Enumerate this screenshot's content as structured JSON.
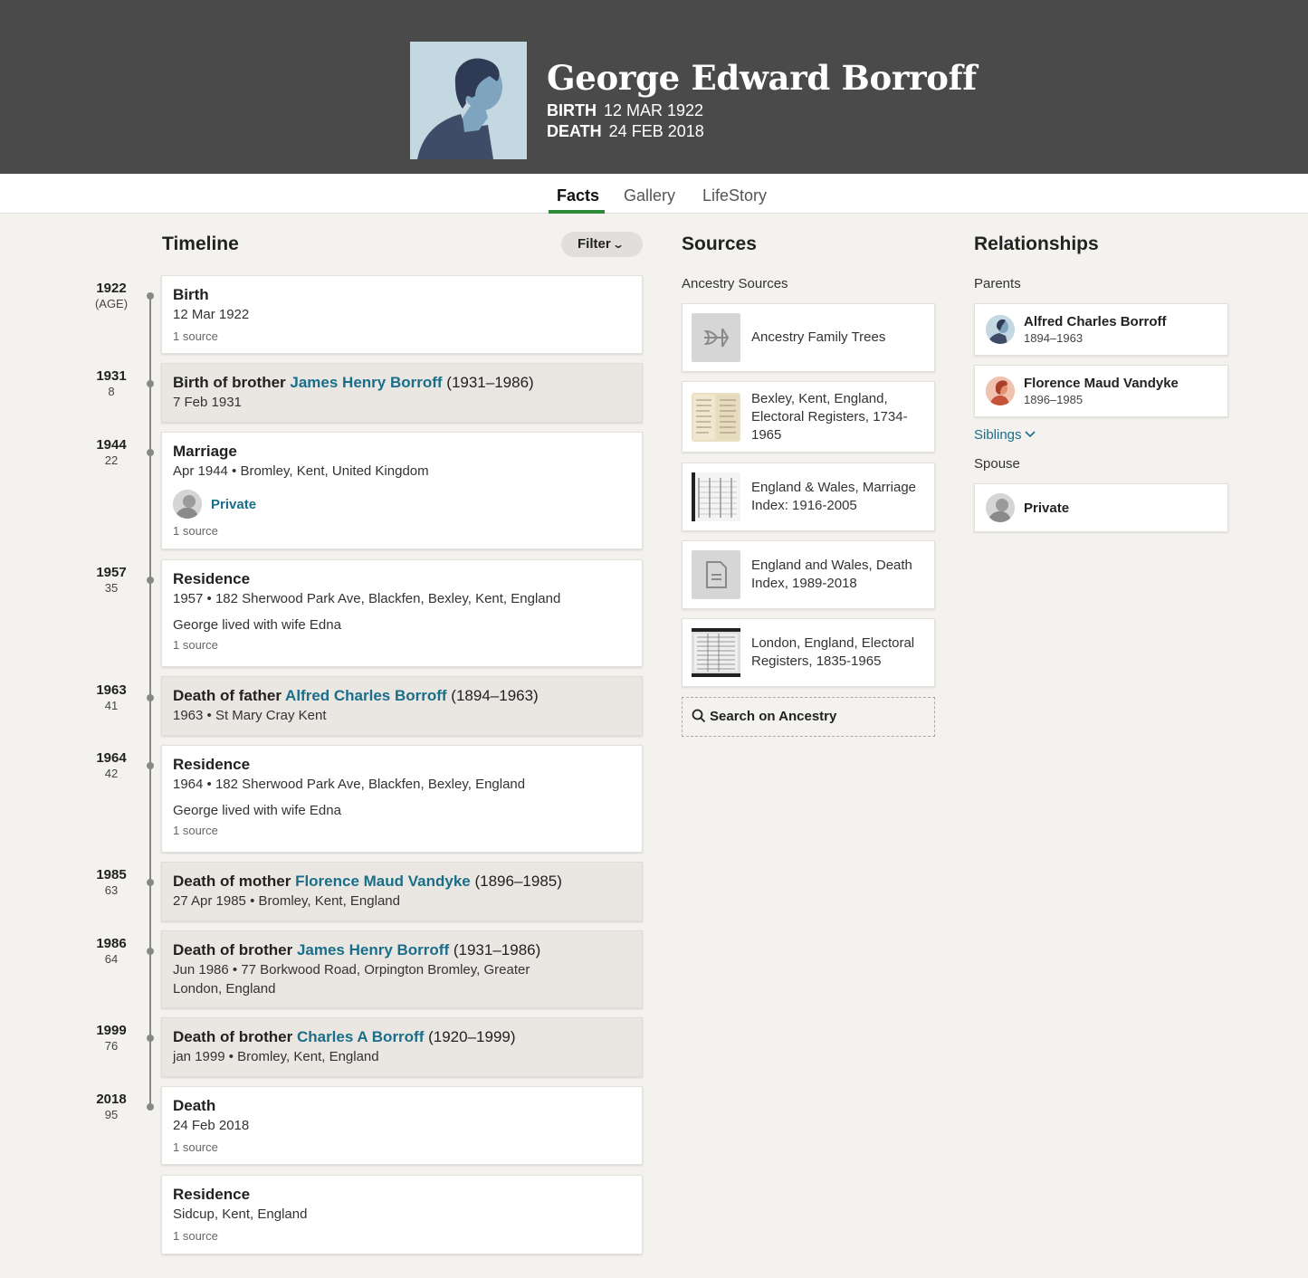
{
  "profile": {
    "name": "George Edward Borroff",
    "birth_label": "BIRTH",
    "birth_date": "12 MAR 1922",
    "death_label": "DEATH",
    "death_date": "24 FEB 2018"
  },
  "tabs": [
    "Facts",
    "Gallery",
    "LifeStory"
  ],
  "timeline": {
    "heading": "Timeline",
    "filter_label": "Filter",
    "years": [
      {
        "year": "1922",
        "age": "(AGE)"
      },
      {
        "year": "1931",
        "age": "8"
      },
      {
        "year": "1944",
        "age": "22"
      },
      {
        "year": "1957",
        "age": "35"
      },
      {
        "year": "1963",
        "age": "41"
      },
      {
        "year": "1964",
        "age": "42"
      },
      {
        "year": "1985",
        "age": "63"
      },
      {
        "year": "1986",
        "age": "64"
      },
      {
        "year": "1999",
        "age": "76"
      },
      {
        "year": "2018",
        "age": "95"
      }
    ],
    "events": [
      {
        "title": "Birth",
        "detail": "12 Mar 1922",
        "source": "1 source"
      },
      {
        "prefix": "Birth of brother ",
        "link": "James Henry Borroff",
        "dates": " (1931–1986)",
        "detail": "7 Feb 1931"
      },
      {
        "title": "Marriage",
        "detail": "Apr 1944 • Bromley, Kent, United Kingdom",
        "spouse": "Private",
        "source": "1 source"
      },
      {
        "title": "Residence",
        "detail": "1957 • 182 Sherwood Park Ave, Blackfen, Bexley, Kent, England",
        "note": "George lived with wife Edna",
        "source": "1 source"
      },
      {
        "prefix": "Death of father ",
        "link": "Alfred Charles Borroff",
        "dates": " (1894–1963)",
        "detail": "1963 • St Mary Cray Kent"
      },
      {
        "title": "Residence",
        "detail": "1964 • 182 Sherwood Park Ave, Blackfen, Bexley, England",
        "note": "George lived with wife Edna",
        "source": "1 source"
      },
      {
        "prefix": "Death of mother ",
        "link": "Florence Maud Vandyke",
        "dates": " (1896–1985)",
        "detail": "27 Apr 1985 • Bromley, Kent, England"
      },
      {
        "prefix": "Death of brother ",
        "link": "James Henry Borroff",
        "dates": " (1931–1986)",
        "detail": "Jun 1986 • 77 Borkwood Road, Orpington Bromley, Greater London, England"
      },
      {
        "prefix": "Death of brother ",
        "link": "Charles A Borroff",
        "dates": " (1920–1999)",
        "detail": "jan 1999 • Bromley, Kent, England"
      },
      {
        "title": "Death",
        "detail": "24 Feb 2018",
        "source": "1 source"
      },
      {
        "title": "Residence",
        "detail": "Sidcup, Kent, England",
        "source": "1 source"
      }
    ]
  },
  "sources": {
    "heading": "Sources",
    "subheading": "Ancestry Sources",
    "items": [
      {
        "title": "Ancestry Family Trees",
        "icon": "leaf-icon"
      },
      {
        "title": "Bexley, Kent, England, Electoral Registers, 1734-1965",
        "icon": "document-scan-thumbnail"
      },
      {
        "title": "England & Wales, Marriage Index: 1916-2005",
        "icon": "index-page-thumbnail"
      },
      {
        "title": "England and Wales, Death Index, 1989-2018",
        "icon": "document-icon"
      },
      {
        "title": "London, England, Electoral Registers, 1835-1965",
        "icon": "register-page-thumbnail"
      }
    ],
    "search_label": "Search on Ancestry"
  },
  "relationships": {
    "heading": "Relationships",
    "parents_label": "Parents",
    "parents": [
      {
        "name": "Alfred Charles Borroff",
        "dates": "1894–1963"
      },
      {
        "name": "Florence Maud Vandyke",
        "dates": "1896–1985"
      }
    ],
    "siblings_label": "Siblings",
    "spouse_label": "Spouse",
    "spouse": {
      "name": "Private"
    }
  },
  "colors": {
    "accent_link": "#1a6e8a",
    "tab_active": "#2e8b3a",
    "header_bg": "#4a4a4a"
  }
}
